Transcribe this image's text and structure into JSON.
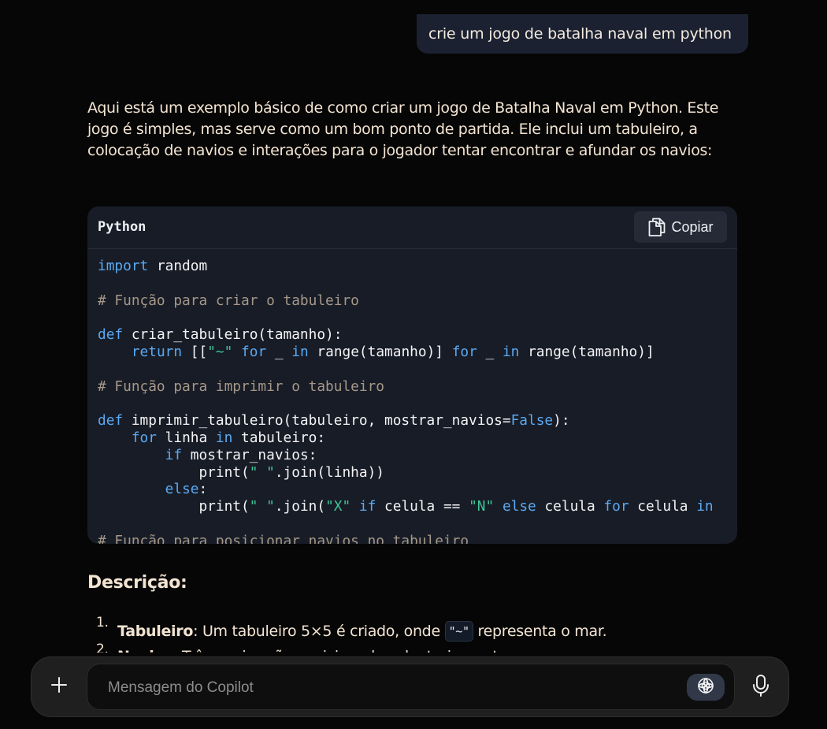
{
  "user_message": "crie um jogo de batalha naval em python",
  "assistant": {
    "intro": "Aqui está um exemplo básico de como criar um jogo de Batalha Naval em Python. Este jogo é simples, mas serve como um bom ponto de partida. Ele inclui um tabuleiro, a colocação de navios e interações para o jogador tentar encontrar e afundar os navios:",
    "code_block": {
      "language": "Python",
      "copy_label": "Copiar"
    },
    "description_heading": "Descrição:",
    "list": [
      {
        "number": "1.",
        "term": "Tabuleiro",
        "text_before": ": Um tabuleiro 5×5 é criado, onde ",
        "code": "\"~\"",
        "text_after": " representa o mar."
      },
      {
        "number": "2.",
        "term": "Navios",
        "text_before": ": Três navios são posicionados aleatoriamente.",
        "code": "",
        "text_after": ""
      }
    ]
  },
  "composer": {
    "placeholder": "Mensagem do Copilot"
  },
  "colors": {
    "background": "#060606",
    "user_bubble": "#1b2130",
    "code_bg": "#181c26",
    "keyword": "#5aa9f2",
    "comment": "#a59889",
    "string": "#3fc59a",
    "text": "#f3e4d2"
  },
  "icons": {
    "copy": "copy-icon",
    "add": "plus-icon",
    "model": "copilot-icon",
    "microphone": "microphone-icon"
  }
}
